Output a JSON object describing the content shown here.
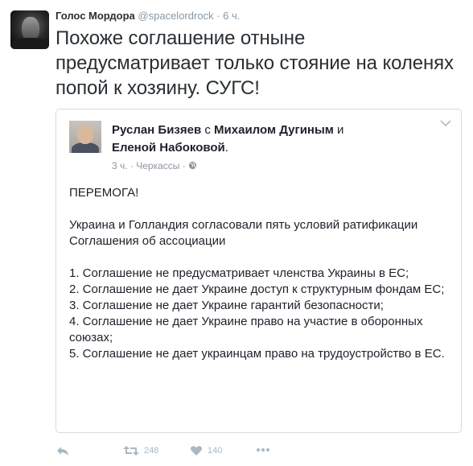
{
  "tweet": {
    "author_name": "Голос Мордора",
    "handle": "@spacelordrock",
    "dot": "·",
    "time": "6 ч.",
    "text": "Похоже соглашение отныне предусматривает только стояние на коленях попой к хозяину. СУГС!"
  },
  "embedded_post": {
    "author": "Руслан Бизяев",
    "with_word": "с",
    "tagged_1": "Михаилом Дугиным",
    "and_word": "и",
    "tagged_2": "Еленой Набоковой",
    "period": ".",
    "meta": "3 ч. · Черкассы ·",
    "body": {
      "heading": "ПЕРЕМОГА!",
      "intro": "Украина и Голландия согласовали пять условий ратификации Соглашения об ассоциации",
      "items": [
        "1. Соглашение не предусматривает членства Украины в ЕС;",
        "2. Соглашение не дает Украине доступ к структурным фондам ЕС;",
        "3. Соглашение не дает Украине гарантий безопасности;",
        "4. Соглашение не дает Украине право на участие в оборонных союзах;",
        "5. Соглашение не дает украинцам право на трудоустройство в ЕС."
      ]
    }
  },
  "actions": {
    "retweet_count": "248",
    "like_count": "140"
  },
  "icons": [
    "reply-icon",
    "retweet-icon",
    "like-icon",
    "more-icon",
    "chevron-down-icon",
    "globe-icon"
  ],
  "colors": {
    "action_gray": "#aab8c2",
    "meta_gray": "#8899a6"
  }
}
